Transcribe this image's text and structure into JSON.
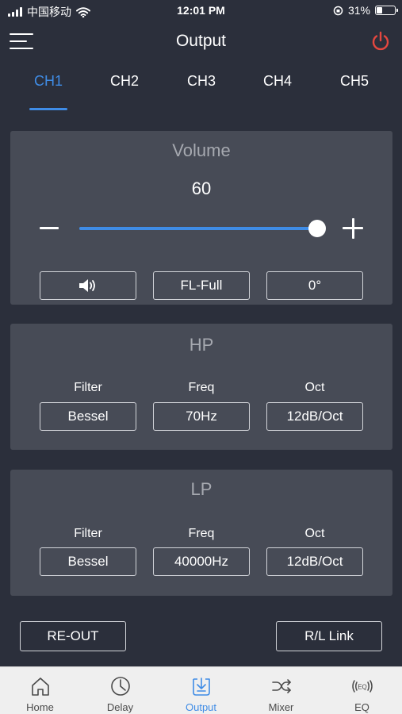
{
  "status_bar": {
    "carrier": "中国移动",
    "time": "12:01 PM",
    "battery": "31%",
    "battery_level": 0.31,
    "icons": [
      "signal-icon",
      "wifi-icon",
      "orientation-lock-icon",
      "battery-icon"
    ]
  },
  "header": {
    "title": "Output",
    "menu_icon": "menu-icon",
    "power_icon": "power-icon"
  },
  "tabs": [
    {
      "label": "CH1",
      "active": true
    },
    {
      "label": "CH2",
      "active": false
    },
    {
      "label": "CH3",
      "active": false
    },
    {
      "label": "CH4",
      "active": false
    },
    {
      "label": "CH5",
      "active": false
    }
  ],
  "volume": {
    "title": "Volume",
    "value": "60",
    "level": 1.0,
    "speaker_icon": "speaker-icon",
    "channel_type": "FL-Full",
    "phase": "0°"
  },
  "hp": {
    "title": "HP",
    "filter_label": "Filter",
    "freq_label": "Freq",
    "oct_label": "Oct",
    "filter": "Bessel",
    "freq": "70Hz",
    "oct": "12dB/Oct"
  },
  "lp": {
    "title": "LP",
    "filter_label": "Filter",
    "freq_label": "Freq",
    "oct_label": "Oct",
    "filter": "Bessel",
    "freq": "40000Hz",
    "oct": "12dB/Oct"
  },
  "actions": {
    "reout": "RE-OUT",
    "rl_link": "R/L Link"
  },
  "nav": [
    {
      "label": "Home",
      "icon": "home-icon",
      "active": false
    },
    {
      "label": "Delay",
      "icon": "clock-icon",
      "active": false
    },
    {
      "label": "Output",
      "icon": "output-icon",
      "active": true
    },
    {
      "label": "Mixer",
      "icon": "shuffle-icon",
      "active": false
    },
    {
      "label": "EQ",
      "icon": "eq-icon",
      "active": false
    }
  ],
  "colors": {
    "background": "#2b2f3b",
    "panel": "#474b56",
    "accent": "#3f8ce6",
    "power": "#e5473f",
    "nav_background": "#efefef"
  }
}
